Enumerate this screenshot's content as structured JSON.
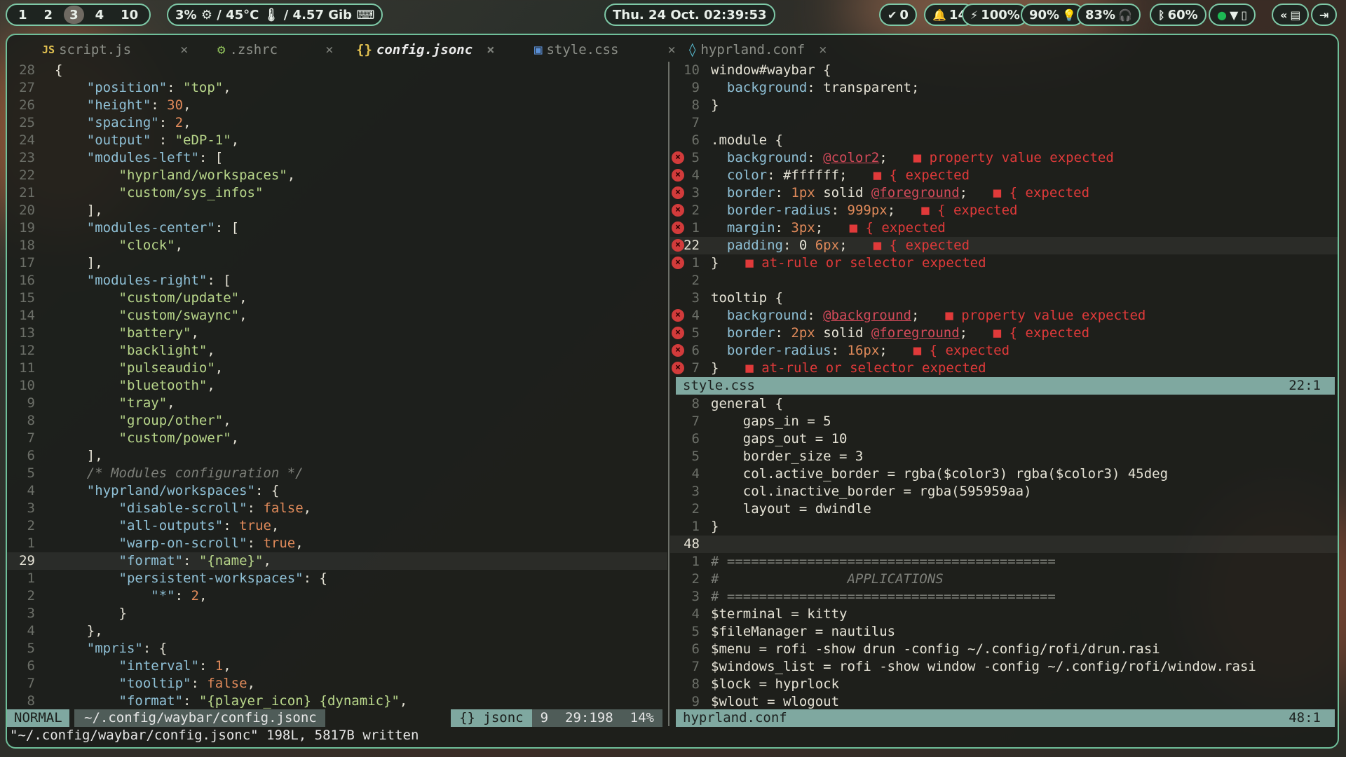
{
  "topbar": {
    "workspaces": [
      "1",
      "2",
      "3",
      "4",
      "10"
    ],
    "active_workspace": "3",
    "sys_infos": "3% ⚙ / 45°C 🌡 / 4.57 Gib ⌨",
    "clock": "Thu. 24 Oct. 02:39:53",
    "updates": "0",
    "notifications": "14",
    "battery": "100%",
    "backlight": "90%",
    "pulseaudio": "83%",
    "bluetooth": "60%"
  },
  "tabs": [
    {
      "icon": "JS",
      "label": "script.js",
      "close": "×"
    },
    {
      "icon": "⚙",
      "label": ".zshrc",
      "close": "×"
    },
    {
      "icon": "{}",
      "label": "config.jsonc",
      "close": "×"
    },
    {
      "icon": "▣",
      "label": "style.css",
      "close": "×"
    },
    {
      "icon": "◊",
      "label": "hyprland.conf",
      "close": "×"
    }
  ],
  "left_pane": {
    "lines": [
      {
        "n": "28",
        "t": "{"
      },
      {
        "n": "27",
        "t": "    \"position\": \"top\","
      },
      {
        "n": "26",
        "t": "    \"height\": 30,"
      },
      {
        "n": "25",
        "t": "    \"spacing\": 2,"
      },
      {
        "n": "24",
        "t": "    \"output\" : \"eDP-1\","
      },
      {
        "n": "23",
        "t": "    \"modules-left\": ["
      },
      {
        "n": "22",
        "t": "        \"hyprland/workspaces\","
      },
      {
        "n": "21",
        "t": "        \"custom/sys_infos\""
      },
      {
        "n": "20",
        "t": "    ],"
      },
      {
        "n": "19",
        "t": "    \"modules-center\": ["
      },
      {
        "n": "18",
        "t": "        \"clock\","
      },
      {
        "n": "17",
        "t": "    ],"
      },
      {
        "n": "16",
        "t": "    \"modules-right\": ["
      },
      {
        "n": "15",
        "t": "        \"custom/update\","
      },
      {
        "n": "14",
        "t": "        \"custom/swaync\","
      },
      {
        "n": "13",
        "t": "        \"battery\","
      },
      {
        "n": "12",
        "t": "        \"backlight\","
      },
      {
        "n": "11",
        "t": "        \"pulseaudio\","
      },
      {
        "n": "10",
        "t": "        \"bluetooth\","
      },
      {
        "n": "9",
        "t": "        \"tray\","
      },
      {
        "n": "8",
        "t": "        \"group/other\","
      },
      {
        "n": "7",
        "t": "        \"custom/power\","
      },
      {
        "n": "6",
        "t": "    ],"
      },
      {
        "n": "5",
        "t": "    /* Modules configuration */"
      },
      {
        "n": "4",
        "t": "    \"hyprland/workspaces\": {"
      },
      {
        "n": "3",
        "t": "        \"disable-scroll\": false,"
      },
      {
        "n": "2",
        "t": "        \"all-outputs\": true,"
      },
      {
        "n": "1",
        "t": "        \"warp-on-scroll\": true,"
      },
      {
        "n": "29",
        "t": "        \"format\": \"{name}\","
      },
      {
        "n": "1",
        "t": "        \"persistent-workspaces\": {"
      },
      {
        "n": "2",
        "t": "            \"*\": 2,"
      },
      {
        "n": "3",
        "t": "        }"
      },
      {
        "n": "4",
        "t": "    },"
      },
      {
        "n": "5",
        "t": "    \"mpris\": {"
      },
      {
        "n": "6",
        "t": "        \"interval\": 1,"
      },
      {
        "n": "7",
        "t": "        \"tooltip\": false,"
      },
      {
        "n": "8",
        "t": "        \"format\": \"{player_icon} {dynamic}\","
      }
    ],
    "status": {
      "mode": "NORMAL",
      "path": "~/.config/waybar/config.jsonc",
      "filetype": "{} jsonc",
      "col": "9",
      "pos": "29:198",
      "pct": "14%"
    }
  },
  "right_top": {
    "lines": [
      {
        "n": "10",
        "t": "window#waybar {",
        "d": ""
      },
      {
        "n": "9",
        "t": "  background: transparent;",
        "d": ""
      },
      {
        "n": "8",
        "t": "}",
        "d": ""
      },
      {
        "n": "7",
        "t": "",
        "d": ""
      },
      {
        "n": "6",
        "t": ".module {",
        "d": ""
      },
      {
        "n": "5",
        "t": "  background: @color2;",
        "d": "■ property value expected"
      },
      {
        "n": "4",
        "t": "  color: #ffffff;",
        "d": "■ { expected"
      },
      {
        "n": "3",
        "t": "  border: 1px solid @foreground;",
        "d": "■ { expected"
      },
      {
        "n": "2",
        "t": "  border-radius: 999px;",
        "d": "■ { expected"
      },
      {
        "n": "1",
        "t": "  margin: 3px;",
        "d": "■ { expected"
      },
      {
        "n": "22",
        "t": "  padding: 0 6px;",
        "d": "■ { expected"
      },
      {
        "n": "1",
        "t": "}",
        "d": "■ at-rule or selector expected"
      },
      {
        "n": "2",
        "t": "",
        "d": ""
      },
      {
        "n": "3",
        "t": "tooltip {",
        "d": ""
      },
      {
        "n": "4",
        "t": "  background: @background;",
        "d": "■ property value expected"
      },
      {
        "n": "5",
        "t": "  border: 2px solid @foreground;",
        "d": "■ { expected"
      },
      {
        "n": "6",
        "t": "  border-radius: 16px;",
        "d": "■ { expected"
      },
      {
        "n": "7",
        "t": "}",
        "d": "■ at-rule or selector expected"
      }
    ],
    "status_name": "style.css",
    "status_pos": "22:1"
  },
  "right_bottom": {
    "lines": [
      {
        "n": "8",
        "t": "general {"
      },
      {
        "n": "7",
        "t": "    gaps_in = 5"
      },
      {
        "n": "6",
        "t": "    gaps_out = 10"
      },
      {
        "n": "5",
        "t": "    border_size = 3"
      },
      {
        "n": "4",
        "t": "    col.active_border = rgba($color3) rgba($color3) 45deg"
      },
      {
        "n": "3",
        "t": "    col.inactive_border = rgba(595959aa)"
      },
      {
        "n": "2",
        "t": "    layout = dwindle"
      },
      {
        "n": "1",
        "t": "}"
      },
      {
        "n": "48",
        "t": ""
      },
      {
        "n": "1",
        "t": "# ========================================="
      },
      {
        "n": "2",
        "t": "#                APPLICATIONS"
      },
      {
        "n": "3",
        "t": "# ========================================="
      },
      {
        "n": "4",
        "t": "$terminal = kitty"
      },
      {
        "n": "5",
        "t": "$fileManager = nautilus"
      },
      {
        "n": "6",
        "t": "$menu = rofi -show drun -config ~/.config/rofi/drun.rasi"
      },
      {
        "n": "7",
        "t": "$windows_list = rofi -show window -config ~/.config/rofi/window.rasi"
      },
      {
        "n": "8",
        "t": "$lock = hyprlock"
      },
      {
        "n": "9",
        "t": "$wlout = wlogout"
      }
    ],
    "status_name": "hyprland.conf",
    "status_pos": "48:1"
  },
  "cmdline": "\"~/.config/waybar/config.jsonc\" 198L, 5817B written",
  "colors": {
    "accent": "#7ec9a7",
    "error": "#e03a3a",
    "string": "#b8d68a",
    "key": "#8fc0d6",
    "number": "#e08a5a"
  }
}
